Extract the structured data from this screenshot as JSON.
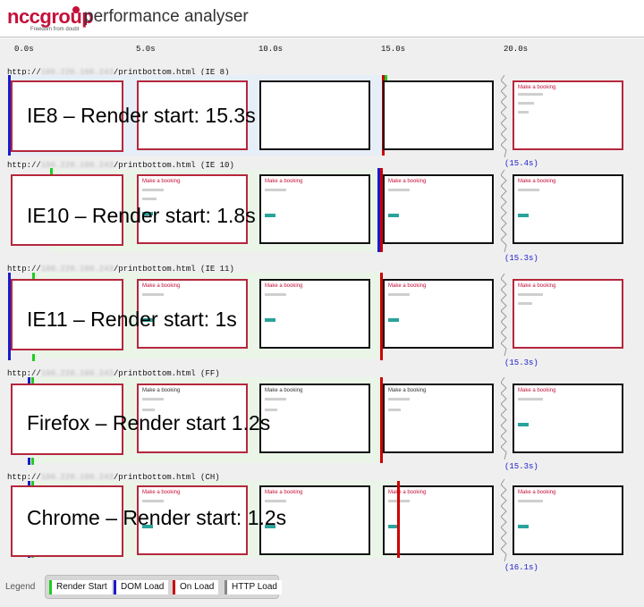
{
  "header": {
    "logo_text": "nccgroup",
    "tagline": "Freedom from doubt",
    "title": "performance analyser"
  },
  "timeline": {
    "ticks": [
      "0.0s",
      "5.0s",
      "10.0s",
      "15.0s",
      "20.0s"
    ]
  },
  "rows": [
    {
      "url_prefix": "http://",
      "url_host": "100.220.100.243",
      "url_path": "/printbottom.html (IE 8)",
      "overlay": "IE8 – Render start: 15.3s",
      "end_time": "(15.4s)"
    },
    {
      "url_prefix": "http://",
      "url_host": "100.220.100.243",
      "url_path": "/printbottom.html (IE 10)",
      "overlay": "IE10 – Render start: 1.8s",
      "end_time": "(15.3s)"
    },
    {
      "url_prefix": "http://",
      "url_host": "100.220.100.243",
      "url_path": "/printbottom.html (IE 11)",
      "overlay": "IE11 – Render start: 1s",
      "end_time": "(15.3s)"
    },
    {
      "url_prefix": "http://",
      "url_host": "100.220.100.243",
      "url_path": "/printbottom.html (FF)",
      "overlay": "Firefox – Render start 1.2s",
      "end_time": "(15.3s)"
    },
    {
      "url_prefix": "http://",
      "url_host": "100.220.100.243",
      "url_path": "/printbottom.html (CH)",
      "overlay": "Chrome – Render start: 1.2s",
      "end_time": "(16.1s)"
    }
  ],
  "thumbnail": {
    "title": "Make a booking"
  },
  "legend": {
    "label": "Legend",
    "items": [
      "Render Start",
      "DOM Load",
      "On Load",
      "HTTP Load"
    ]
  },
  "colors": {
    "brand": "#c4113a",
    "render_start": "#22cc22",
    "dom_load": "#1a1acc",
    "on_load": "#cc0000",
    "http_load": "#888888"
  }
}
